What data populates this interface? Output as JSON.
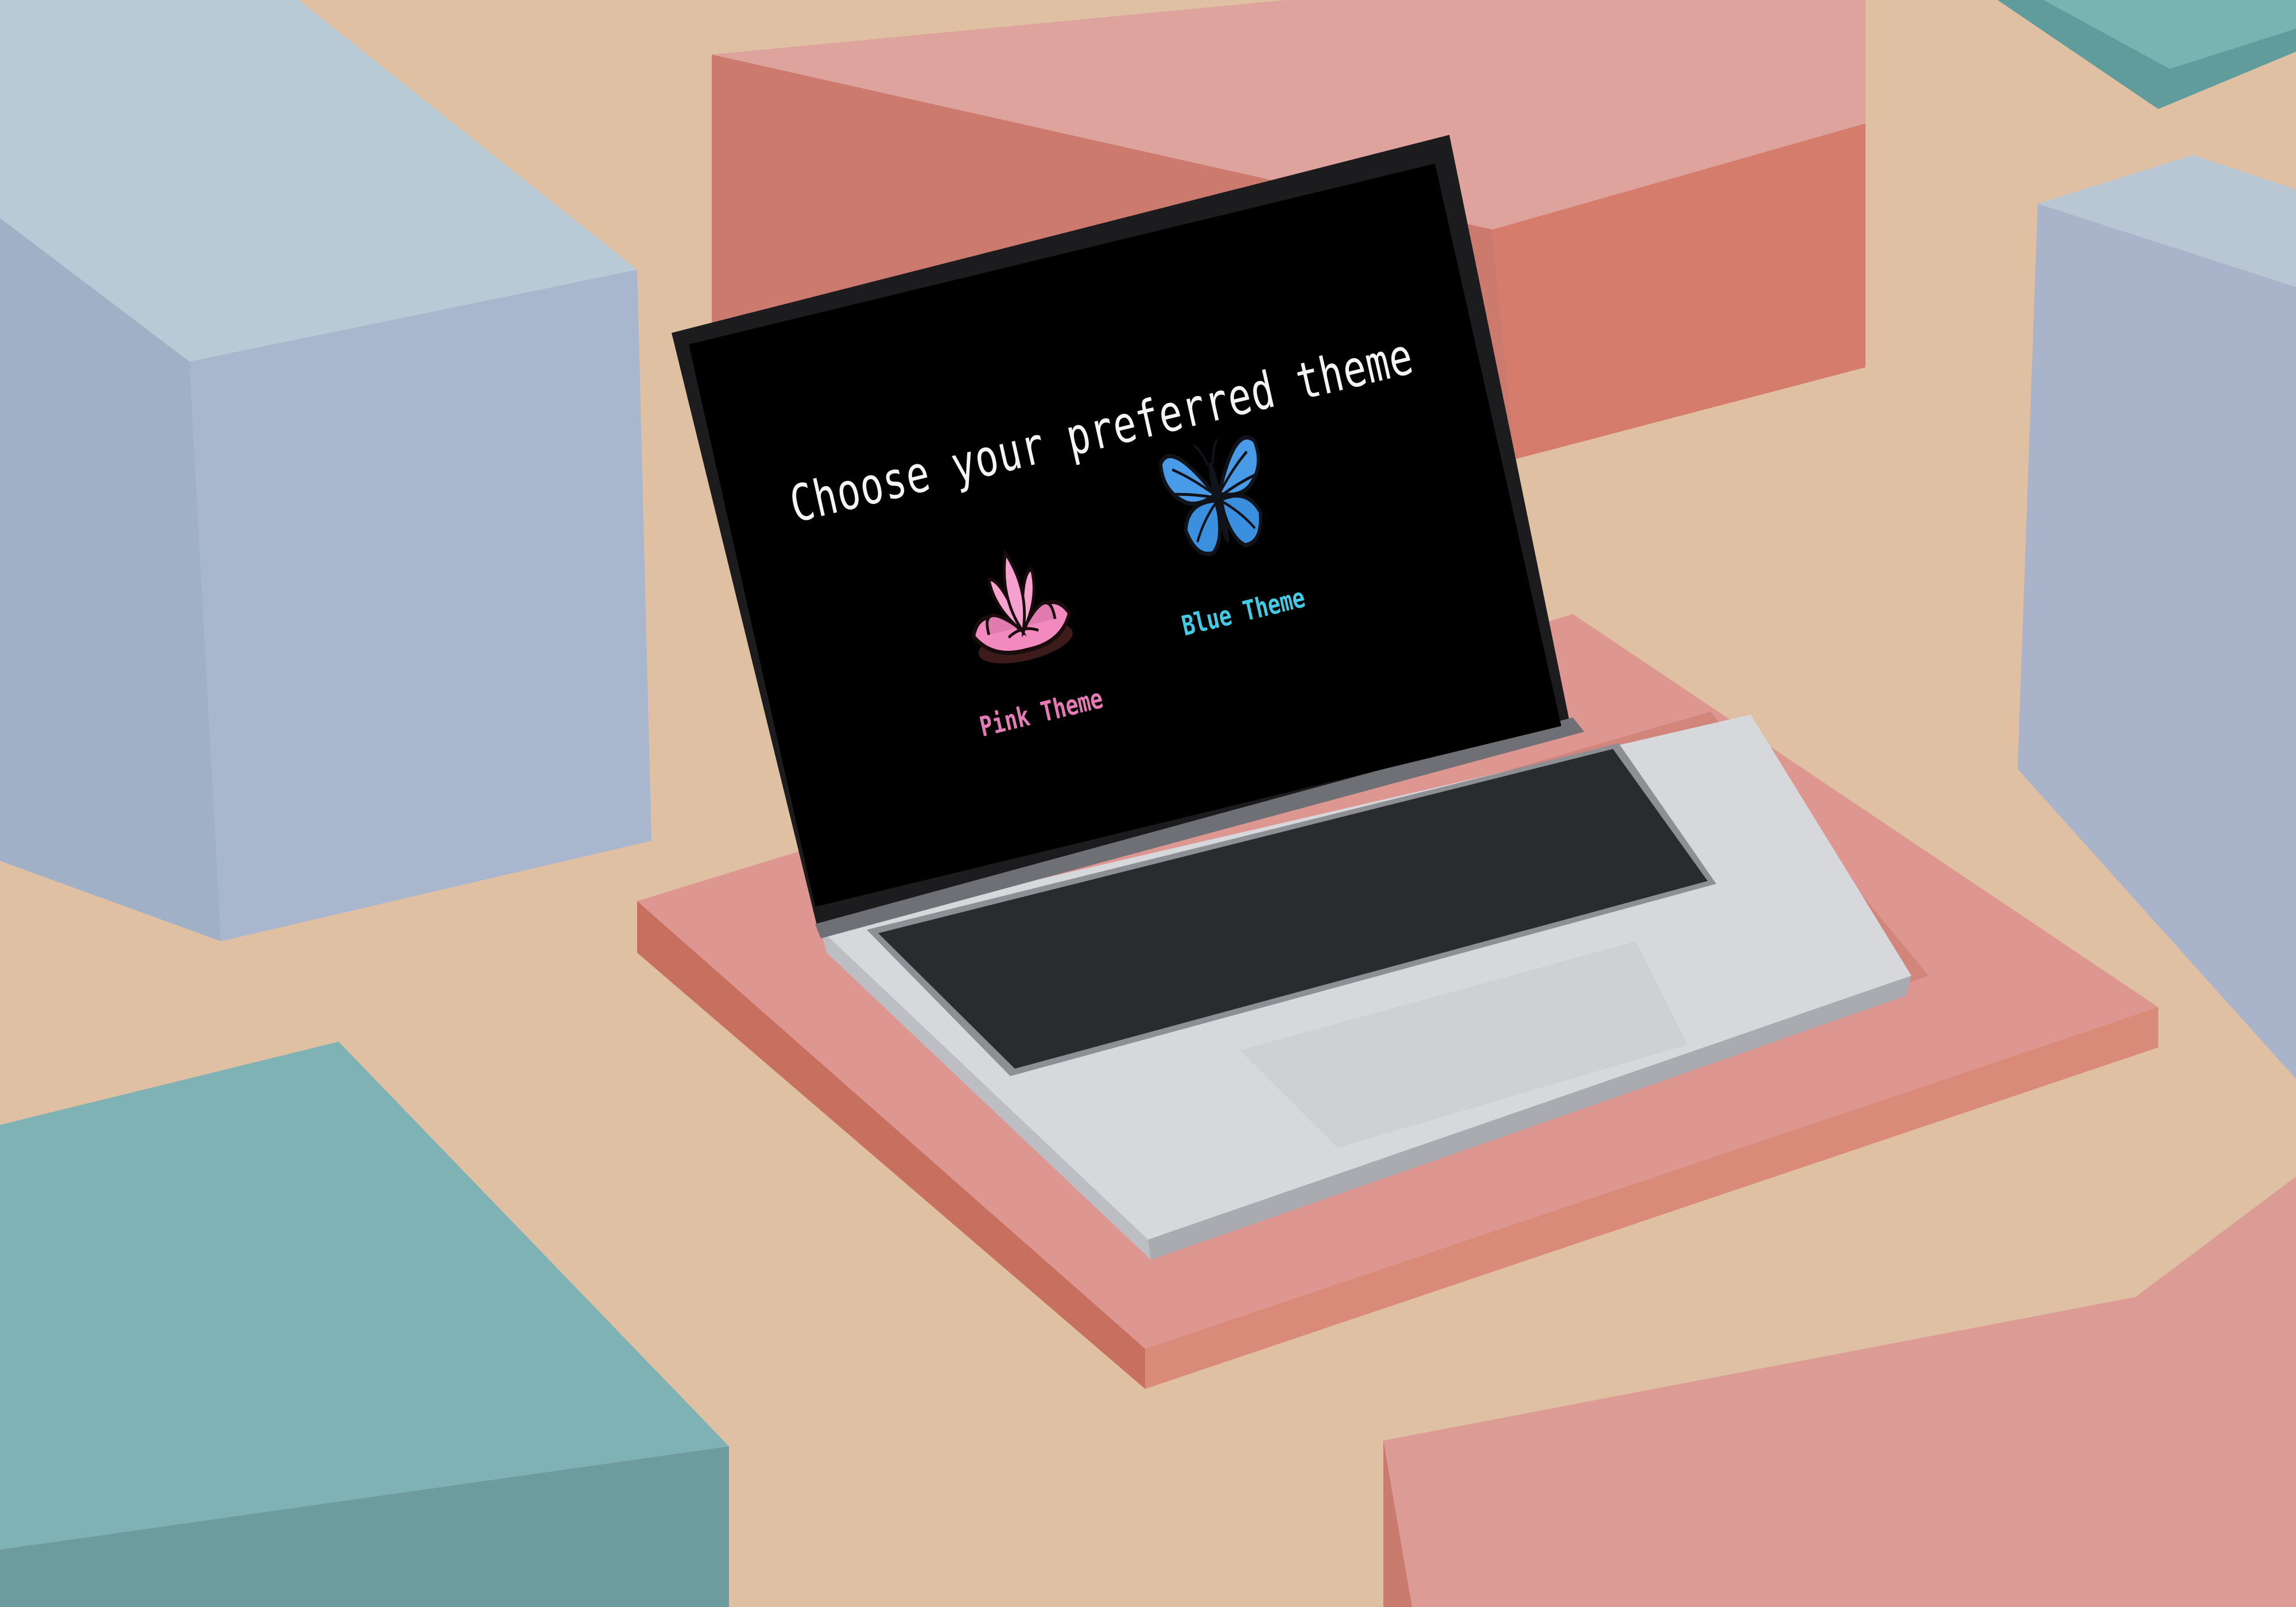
{
  "screen": {
    "title": "Choose your preferred theme",
    "options": [
      {
        "label": "Pink Theme",
        "icon": "lotus-icon",
        "color": "#e47ab6"
      },
      {
        "label": "Blue Theme",
        "icon": "butterfly-icon",
        "color": "#43cbe6"
      }
    ]
  }
}
